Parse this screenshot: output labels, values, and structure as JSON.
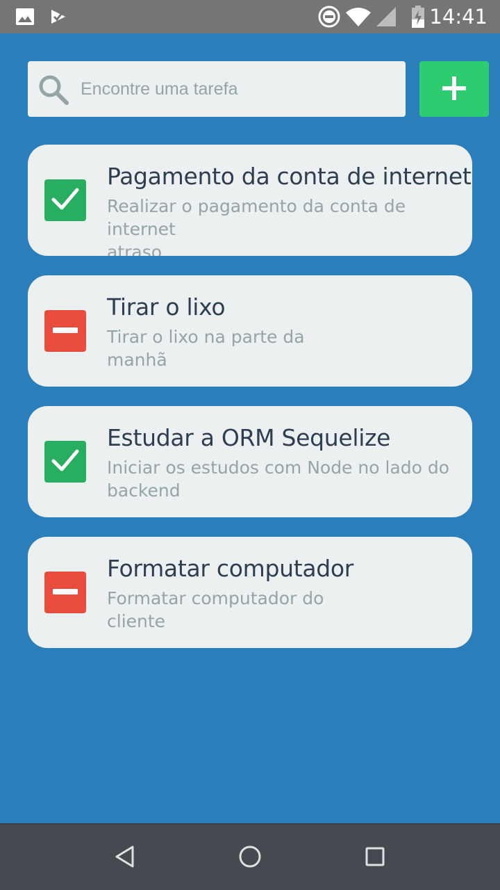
{
  "status_bar": {
    "time": "14:41",
    "icons": [
      "image-icon",
      "check-app-icon",
      "do-not-disturb-icon",
      "wifi-icon",
      "signal-icon",
      "battery-charging-icon"
    ]
  },
  "search": {
    "placeholder": "Encontre uma tarefa",
    "value": ""
  },
  "colors": {
    "background": "#2a7fba",
    "card": "#ecf0f1",
    "done": "#27ae60",
    "pending": "#e74c3c",
    "add_button": "#2ecc71"
  },
  "tasks": [
    {
      "title": "Pagamento da conta de internet",
      "description": "Realizar o pagamento da conta de internet\natraso",
      "status": "done"
    },
    {
      "title": "Tirar o lixo",
      "description": "Tirar o lixo na parte da\nmanhã",
      "status": "pending"
    },
    {
      "title": "Estudar a ORM Sequelize",
      "description": "Iniciar os estudos com Node no lado do\nbackend",
      "status": "done"
    },
    {
      "title": "Formatar computador",
      "description": "Formatar computador do\ncliente",
      "status": "pending"
    }
  ],
  "nav": {
    "icons": [
      "back-icon",
      "home-icon",
      "recents-icon"
    ]
  }
}
